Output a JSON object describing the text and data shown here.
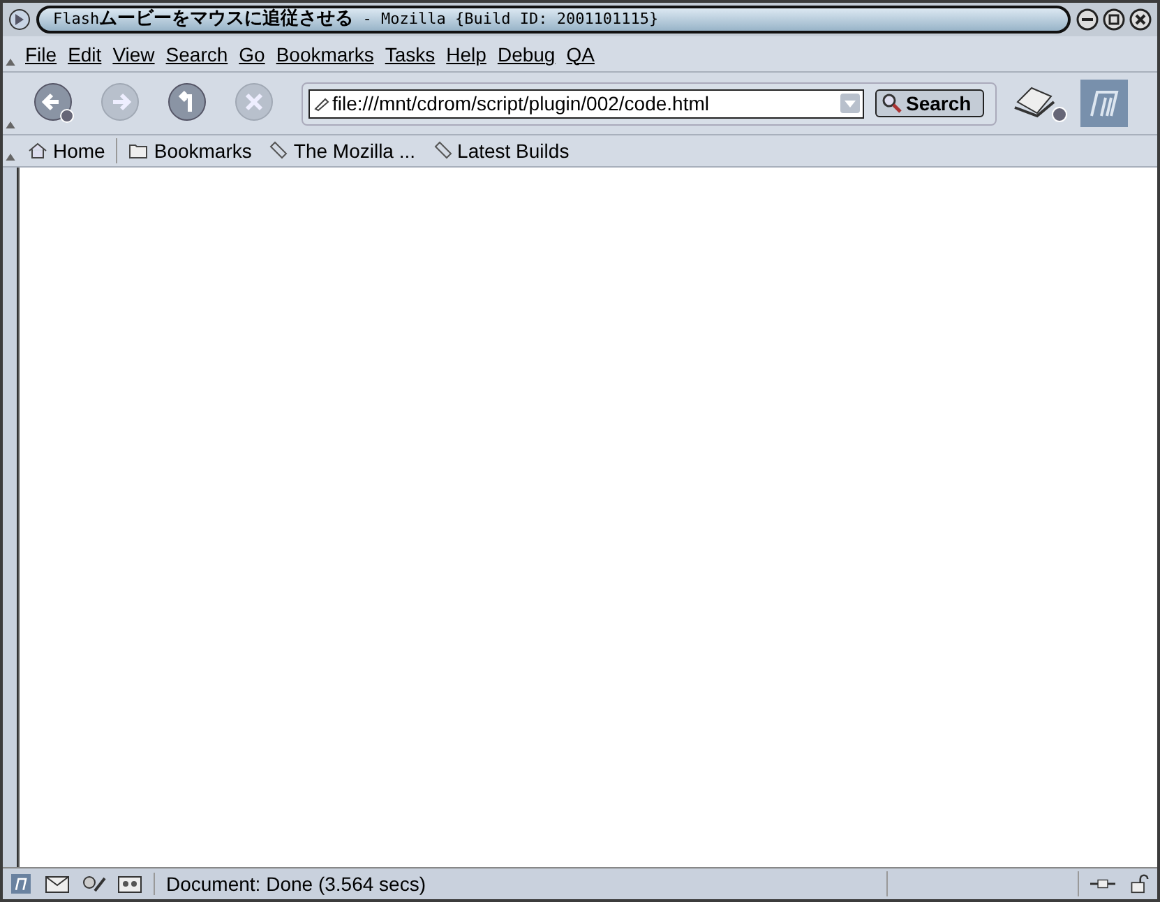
{
  "window": {
    "title": "Flash**ムービーをマウスに追従させる** - Mozilla {Build ID: 2001101115}"
  },
  "menu": [
    "File",
    "Edit",
    "View",
    "Search",
    "Go",
    "Bookmarks",
    "Tasks",
    "Help",
    "Debug",
    "QA"
  ],
  "nav_buttons": [
    {
      "kind": "back",
      "disabled": false
    },
    {
      "kind": "forward",
      "disabled": true
    },
    {
      "kind": "reload",
      "disabled": false
    },
    {
      "kind": "stop",
      "disabled": true
    }
  ],
  "address": {
    "value": "file:///mnt/cdrom/script/plugin/002/code.html"
  },
  "search_button": "Search",
  "bookmarks": [
    {
      "kind": "home",
      "label": "Home"
    },
    {
      "kind": "folder",
      "label": "Bookmarks"
    },
    {
      "kind": "link",
      "label": "The Mozilla ..."
    },
    {
      "kind": "link",
      "label": "Latest Builds"
    }
  ],
  "status_bar": {
    "text": "Document: Done (3.564 secs)"
  }
}
